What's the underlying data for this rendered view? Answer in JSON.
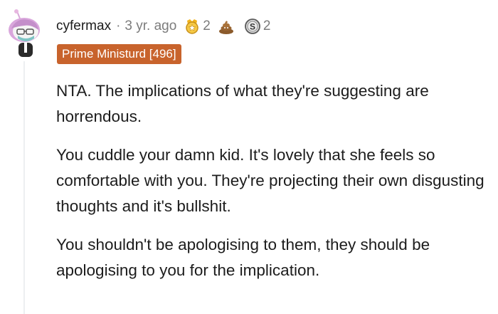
{
  "comment": {
    "author": "cyfermax",
    "separator": "·",
    "timestamp": "3 yr. ago",
    "awards": [
      {
        "icon": "gold-medal-icon",
        "count": "2"
      },
      {
        "icon": "poop-icon",
        "count": ""
      },
      {
        "icon": "silver-coin-icon",
        "count": "2"
      }
    ],
    "flair": "Prime Ministurd [496]",
    "flair_color": "#c8632c",
    "paragraphs": [
      "NTA. The implications of what they're suggesting are horrendous.",
      "You cuddle your damn kid. It's lovely that she feels so comfortable with you. They're projecting their own disgusting thoughts and it's bullshit.",
      "You shouldn't be apologising to them, they should be apologising to you for the implication."
    ]
  }
}
